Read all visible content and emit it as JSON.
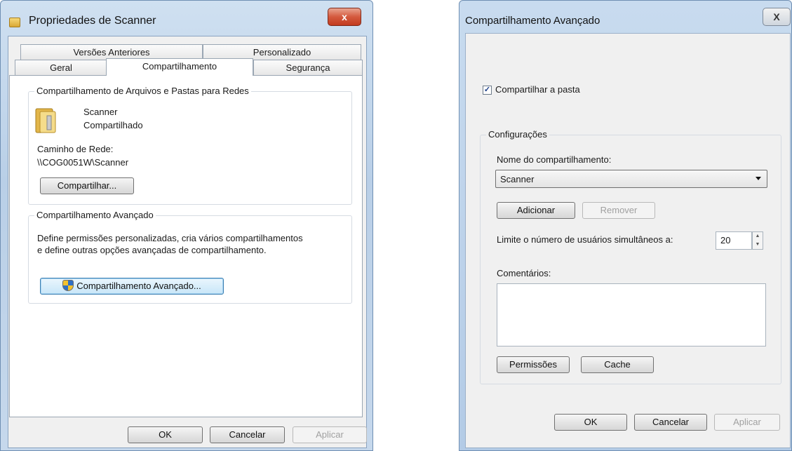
{
  "properties_window": {
    "title": "Propriedades de Scanner",
    "close_label": "x",
    "tabs_row_top": [
      "Versões Anteriores",
      "Personalizado"
    ],
    "tabs_row_bottom": [
      "Geral",
      "Compartilhamento",
      "Segurança"
    ],
    "network_group": {
      "legend": "Compartilhamento de Arquivos e Pastas para Redes",
      "folder_name": "Scanner",
      "folder_status": "Compartilhado",
      "path_label": "Caminho de Rede:",
      "path_value": "\\\\COG0051W\\Scanner",
      "share_button": "Compartilhar..."
    },
    "advanced_group": {
      "legend": "Compartilhamento Avançado",
      "description_line1": "Define permissões personalizadas, cria vários compartilhamentos",
      "description_line2": "e define outras opções avançadas de compartilhamento.",
      "advanced_button": "Compartilhamento Avançado..."
    },
    "footer": {
      "ok": "OK",
      "cancel": "Cancelar",
      "apply": "Aplicar"
    }
  },
  "advanced_window": {
    "title": "Compartilhamento Avançado",
    "close_label": "X",
    "share_checkbox_label": "Compartilhar a pasta",
    "share_checked": true,
    "settings_group": {
      "legend": "Configurações",
      "share_name_label": "Nome do compartilhamento:",
      "share_name_value": "Scanner",
      "add_button": "Adicionar",
      "remove_button": "Remover",
      "limit_label": "Limite o número de usuários simultâneos a:",
      "limit_value": "20",
      "comments_label": "Comentários:",
      "permissions_button": "Permissões",
      "cache_button": "Cache"
    },
    "footer": {
      "ok": "OK",
      "cancel": "Cancelar",
      "apply": "Aplicar"
    }
  }
}
